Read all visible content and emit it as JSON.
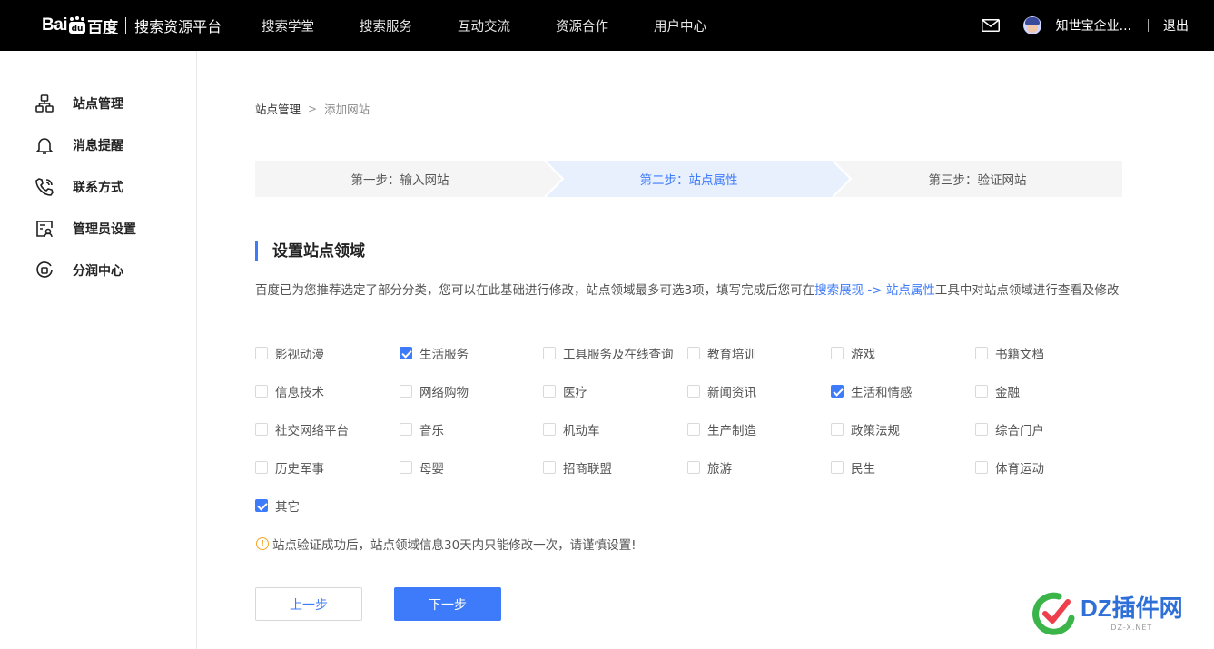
{
  "header": {
    "logo_bai": "Bai",
    "logo_cn": "百度",
    "platform_title": "搜索资源平台",
    "nav": [
      "搜索学堂",
      "搜索服务",
      "互动交流",
      "资源合作",
      "用户中心"
    ],
    "username": "知世宝企业...",
    "logout": "退出"
  },
  "sidebar": {
    "items": [
      {
        "label": "站点管理",
        "icon": "sitemap-icon"
      },
      {
        "label": "消息提醒",
        "icon": "bell-icon"
      },
      {
        "label": "联系方式",
        "icon": "phone-icon"
      },
      {
        "label": "管理员设置",
        "icon": "admin-card-icon"
      },
      {
        "label": "分润中心",
        "icon": "revenue-icon"
      }
    ]
  },
  "breadcrumb": {
    "parent": "站点管理",
    "separator": ">",
    "current": "添加网站"
  },
  "steps": [
    {
      "label": "第一步：输入网站",
      "active": false
    },
    {
      "label": "第二步：站点属性",
      "active": true
    },
    {
      "label": "第三步：验证网站",
      "active": false
    }
  ],
  "section": {
    "title": "设置站点领域",
    "desc_before": "百度已为您推荐选定了部分分类，您可以在此基础进行修改，站点领域最多可选3项，填写完成后您可在",
    "desc_link": "搜索展现 -> 站点属性",
    "desc_after": "工具中对站点领域进行查看及修改"
  },
  "categories": [
    {
      "label": "影视动漫",
      "checked": false
    },
    {
      "label": "生活服务",
      "checked": true
    },
    {
      "label": "工具服务及在线查询",
      "checked": false
    },
    {
      "label": "教育培训",
      "checked": false
    },
    {
      "label": "游戏",
      "checked": false
    },
    {
      "label": "书籍文档",
      "checked": false
    },
    {
      "label": "信息技术",
      "checked": false
    },
    {
      "label": "网络购物",
      "checked": false
    },
    {
      "label": "医疗",
      "checked": false
    },
    {
      "label": "新闻资讯",
      "checked": false
    },
    {
      "label": "生活和情感",
      "checked": true
    },
    {
      "label": "金融",
      "checked": false
    },
    {
      "label": "社交网络平台",
      "checked": false
    },
    {
      "label": "音乐",
      "checked": false
    },
    {
      "label": "机动车",
      "checked": false
    },
    {
      "label": "生产制造",
      "checked": false
    },
    {
      "label": "政策法规",
      "checked": false
    },
    {
      "label": "综合门户",
      "checked": false
    },
    {
      "label": "历史军事",
      "checked": false
    },
    {
      "label": "母婴",
      "checked": false
    },
    {
      "label": "招商联盟",
      "checked": false
    },
    {
      "label": "旅游",
      "checked": false
    },
    {
      "label": "民生",
      "checked": false
    },
    {
      "label": "体育运动",
      "checked": false
    },
    {
      "label": "其它",
      "checked": true
    }
  ],
  "warning": "站点验证成功后，站点领域信息30天内只能修改一次，请谨慎设置!",
  "buttons": {
    "prev": "上一步",
    "next": "下一步"
  },
  "watermark": {
    "title": "DZ插件网",
    "sub": "DZ-X.NET"
  },
  "colors": {
    "accent": "#3e7bfa",
    "topbar": "#000000",
    "step_active_bg": "#e8f0fe",
    "step_bg": "#f5f5f5",
    "warning": "#f5a623"
  }
}
